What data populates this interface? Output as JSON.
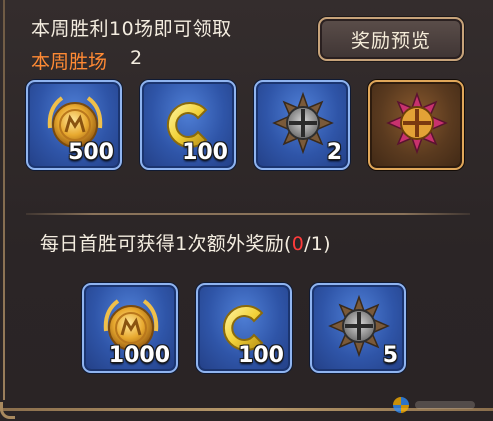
{
  "weekly": {
    "title": "本周胜利10场即可领取",
    "wins_label": "本周胜场",
    "wins_value": "2",
    "preview_button": "奖励预览",
    "rewards": [
      {
        "icon": "gold-medal-icon",
        "count": "500"
      },
      {
        "icon": "c-token-icon",
        "count": "100"
      },
      {
        "icon": "compass-emblem-icon",
        "count": "2"
      },
      {
        "icon": "pink-compass-emblem-icon",
        "count": ""
      }
    ]
  },
  "daily": {
    "text_before": "每日首胜可获得1次额外奖励(",
    "current": "0",
    "text_after": "/1)",
    "rewards": [
      {
        "icon": "gold-medal-icon",
        "count": "1000"
      },
      {
        "icon": "c-token-icon",
        "count": "100"
      },
      {
        "icon": "compass-emblem-icon",
        "count": "5"
      }
    ]
  },
  "colors": {
    "accent_orange": "#ff8a34",
    "alert_red": "#ff3b3b",
    "slot_blue": "#2f55a8",
    "slot_gold_border": "#e0a75a"
  }
}
